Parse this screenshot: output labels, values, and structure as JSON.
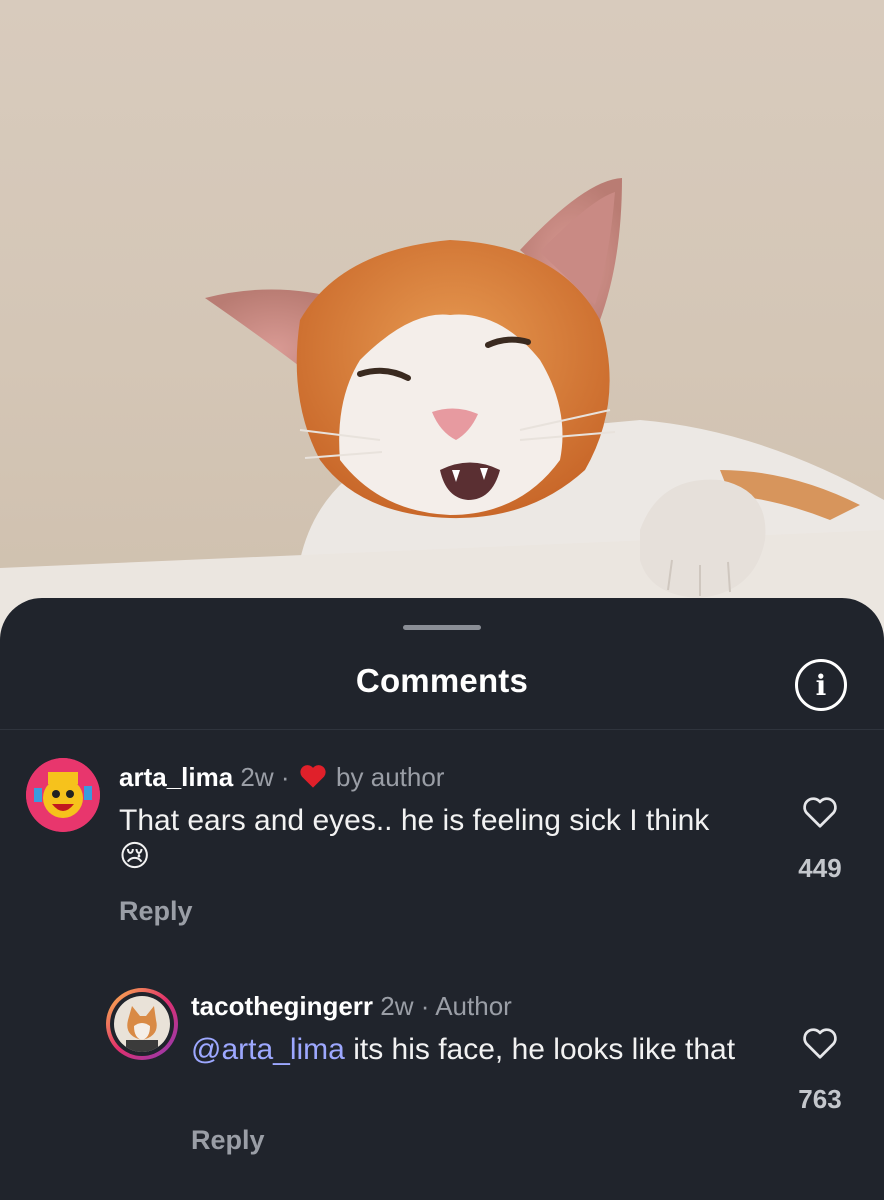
{
  "sheet": {
    "title": "Comments",
    "info_icon": "info-icon"
  },
  "comments": [
    {
      "username": "arta_lima",
      "age": "2w",
      "separator": "·",
      "liked_by_author_text": "by author",
      "text": "That ears and eyes.. he is feeling sick I think",
      "emoji": "😢",
      "reply_label": "Reply",
      "like_count": "449"
    },
    {
      "username": "tacothegingerr",
      "age": "2w",
      "separator": "·",
      "author_badge": "Author",
      "mention": "@arta_lima",
      "text": "its his face, he looks like that",
      "reply_label": "Reply",
      "like_count": "763"
    }
  ],
  "colors": {
    "sheet_bg": "#20242c",
    "mention": "#9da8ff",
    "heart_red": "#e0202a",
    "muted_text": "#9a9ea6"
  }
}
